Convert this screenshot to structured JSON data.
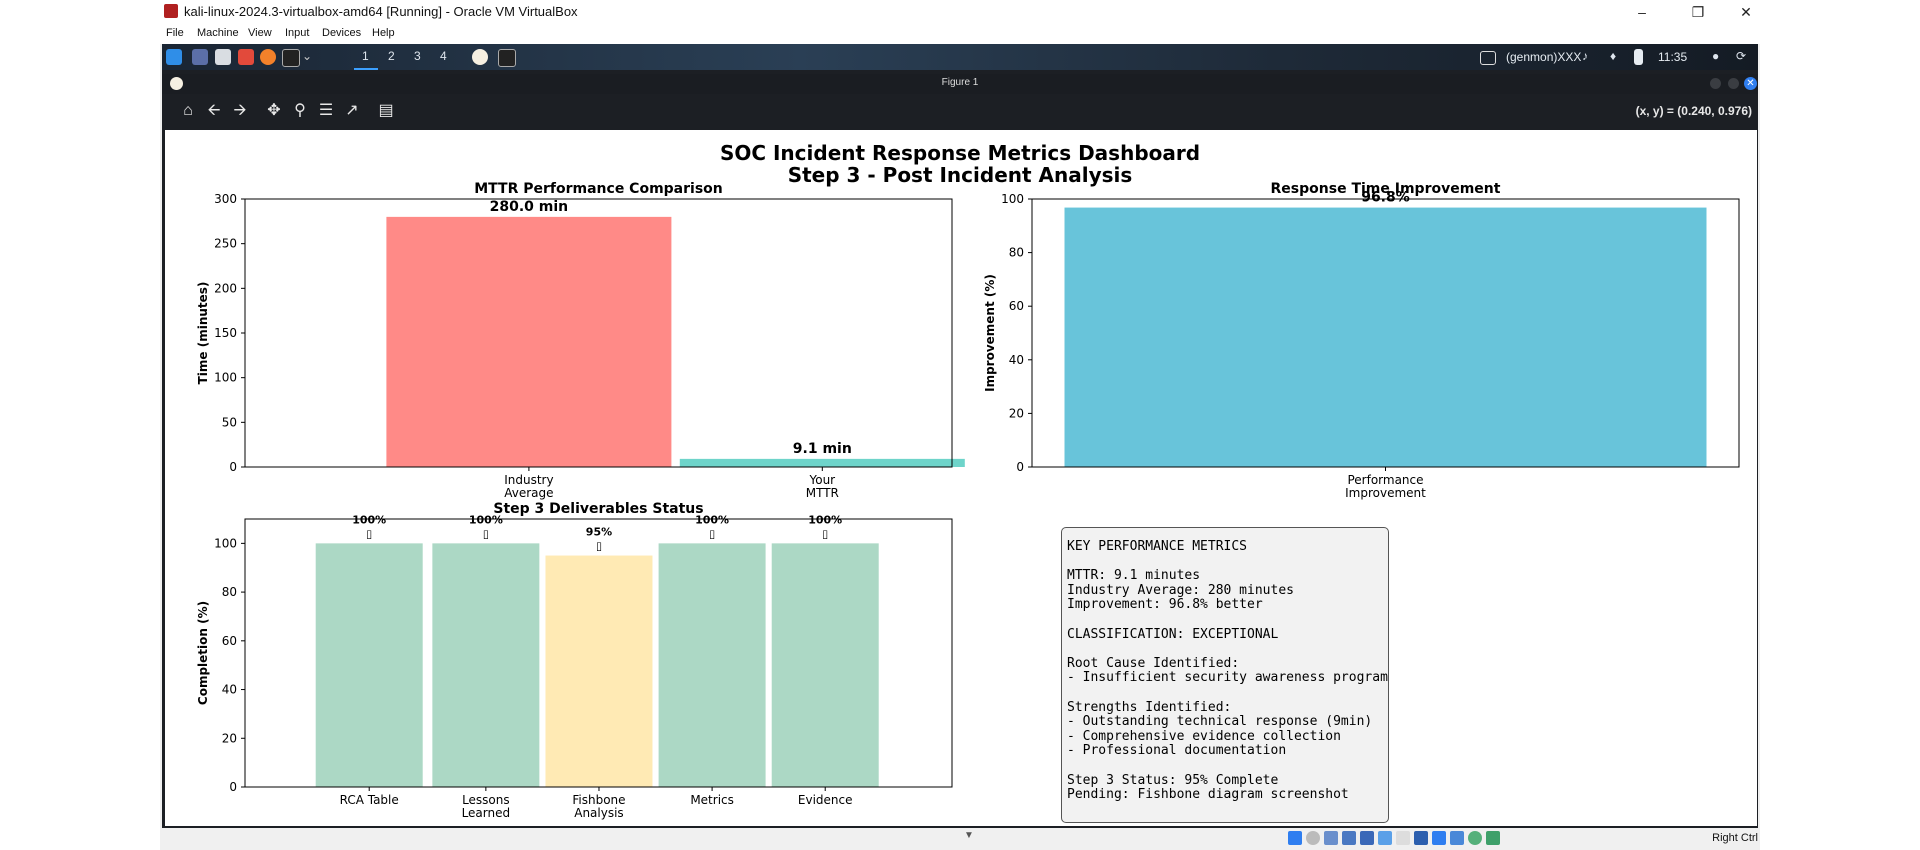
{
  "window": {
    "title": "kali-linux-2024.3-virtualbox-amd64 [Running] - Oracle VM VirtualBox",
    "menu": [
      "File",
      "Machine",
      "View",
      "Input",
      "Devices",
      "Help"
    ],
    "host_key_label": "Right Ctrl"
  },
  "kali_panel": {
    "workspaces": [
      "1",
      "2",
      "3",
      "4"
    ],
    "user": "(genmon)XXX",
    "clock": "11:35"
  },
  "figure": {
    "window_title": "Figure 1",
    "coord_readout": "(x, y) = (0.240, 0.976)",
    "suptitle_line1": "SOC Incident Response Metrics Dashboard",
    "suptitle_line2": "Step 3 - Post Incident Analysis"
  },
  "chart_data": [
    {
      "type": "bar",
      "title": "MTTR Performance Comparison",
      "ylabel": "Time (minutes)",
      "xlabel": "",
      "categories": [
        "Industry\nAverage",
        "Your\nMTTR"
      ],
      "values": [
        280.0,
        9.1
      ],
      "value_labels": [
        "280.0 min",
        "9.1 min"
      ],
      "colors": [
        "#ff8a87",
        "#6ed4ca"
      ],
      "ylim": [
        0,
        300
      ],
      "yticks": [
        0,
        50,
        100,
        150,
        200,
        250,
        300
      ]
    },
    {
      "type": "bar",
      "title": "Response Time Improvement",
      "ylabel": "Improvement (%)",
      "xlabel": "",
      "categories": [
        "Performance\nImprovement"
      ],
      "values": [
        96.8
      ],
      "value_labels": [
        "96.8%"
      ],
      "colors": [
        "#68c4da"
      ],
      "ylim": [
        0,
        100
      ],
      "yticks": [
        0,
        20,
        40,
        60,
        80,
        100
      ]
    },
    {
      "type": "bar",
      "title": "Step 3 Deliverables Status",
      "ylabel": "Completion (%)",
      "xlabel": "",
      "categories": [
        "RCA Table",
        "Lessons\nLearned",
        "Fishbone\nAnalysis",
        "Metrics",
        "Evidence"
      ],
      "values": [
        100,
        100,
        95,
        100,
        100
      ],
      "value_labels": [
        "100%",
        "100%",
        "95%",
        "100%",
        "100%"
      ],
      "status_glyph": "▯",
      "colors": [
        "#acd8c5",
        "#acd8c5",
        "#ffeab4",
        "#acd8c5",
        "#acd8c5"
      ],
      "ylim": [
        0,
        110
      ],
      "yticks": [
        0,
        20,
        40,
        60,
        80,
        100
      ]
    }
  ],
  "metrics_panel": {
    "text": "KEY PERFORMANCE METRICS\n\nMTTR: 9.1 minutes\nIndustry Average: 280 minutes\nImprovement: 96.8% better\n\nCLASSIFICATION: EXCEPTIONAL\n\nRoot Cause Identified:\n- Insufficient security awareness program\n\nStrengths Identified:\n- Outstanding technical response (9min)\n- Comprehensive evidence collection\n- Professional documentation\n\nStep 3 Status: 95% Complete\nPending: Fishbone diagram screenshot"
  }
}
